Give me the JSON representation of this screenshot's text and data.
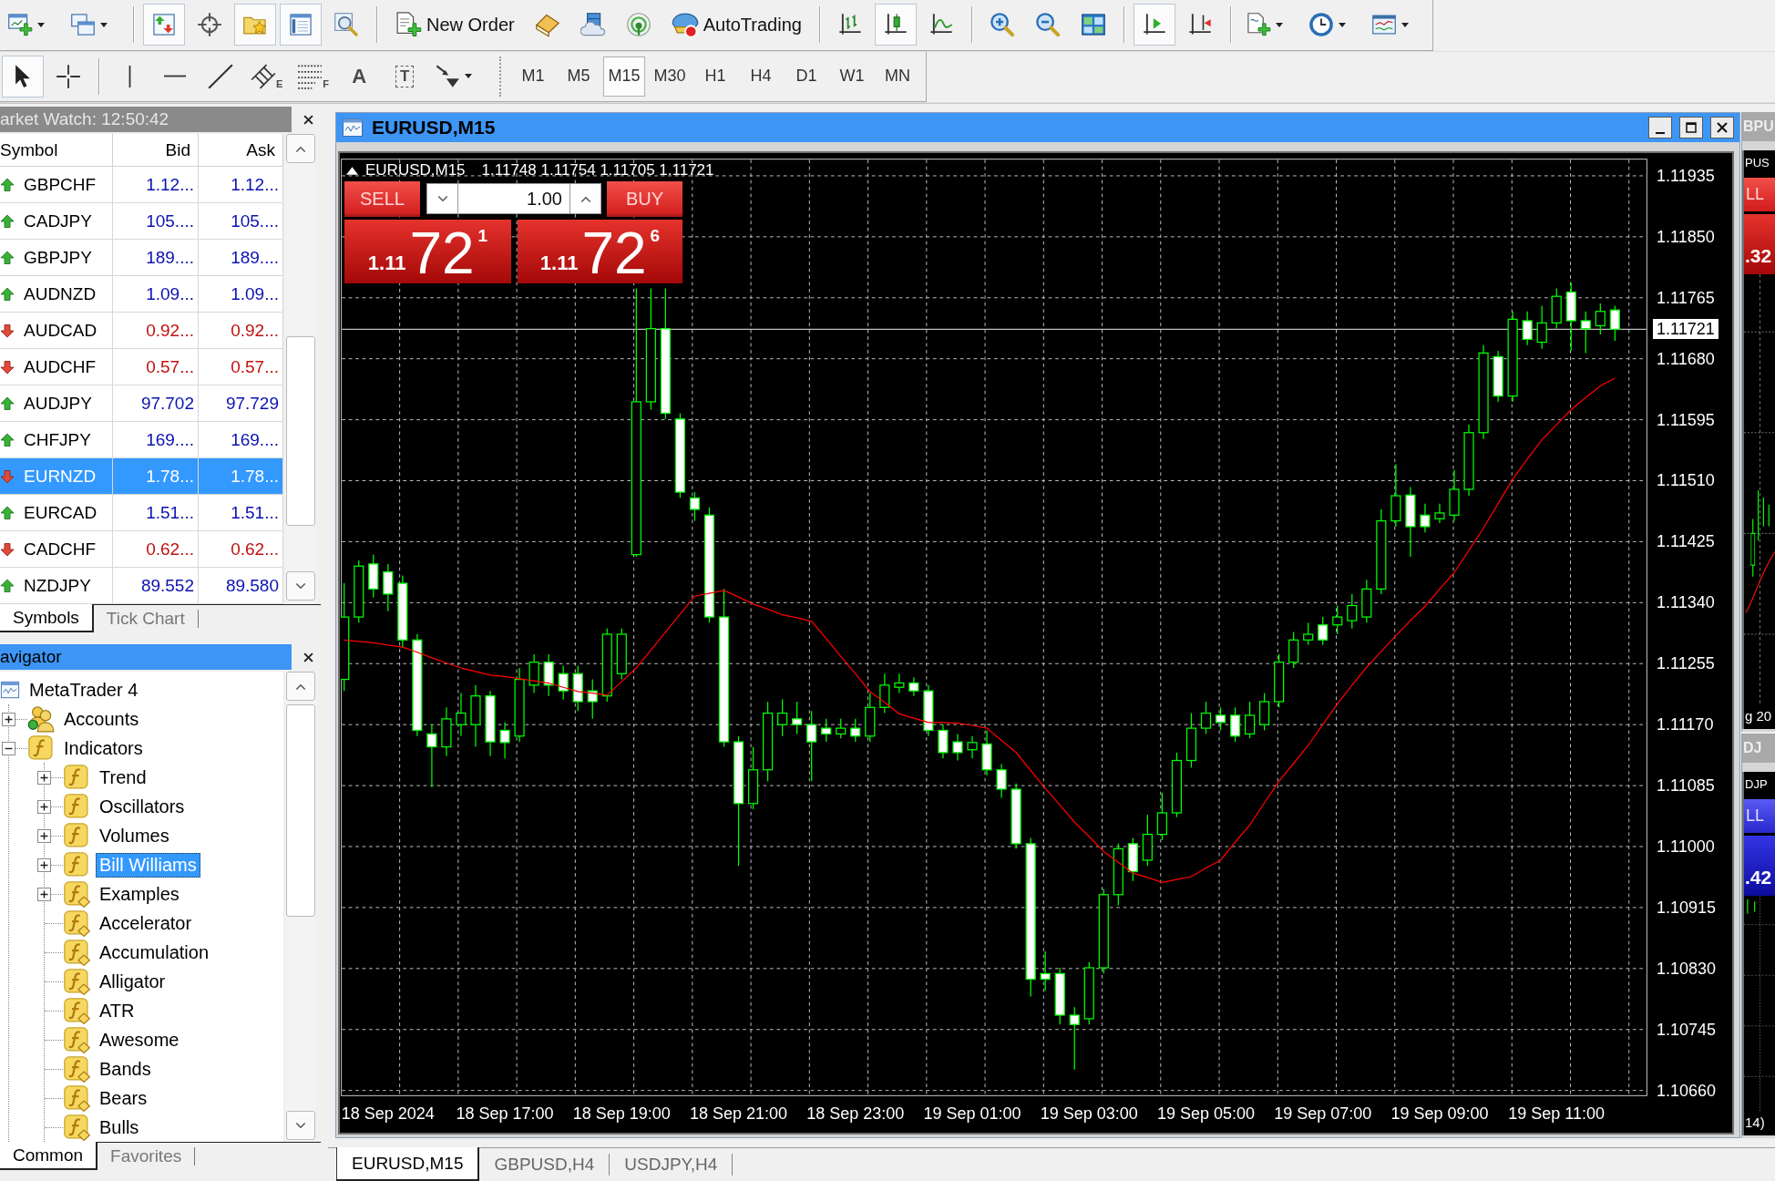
{
  "toolbars": [
    {
      "items": [
        {
          "kind": "new-chart",
          "dropdown": true,
          "pressed": false
        },
        {
          "kind": "profiles",
          "dropdown": true,
          "pressed": false
        },
        {
          "kind": "separator"
        },
        {
          "kind": "market-watch",
          "dropdown": false,
          "pressed": true
        },
        {
          "kind": "data-window",
          "dropdown": false,
          "pressed": false
        },
        {
          "kind": "navigator",
          "dropdown": false,
          "pressed": true
        },
        {
          "kind": "terminal",
          "dropdown": false,
          "pressed": true
        },
        {
          "kind": "tester",
          "dropdown": false,
          "pressed": false
        },
        {
          "kind": "separator"
        },
        {
          "kind": "new-order",
          "label": "New Order",
          "dropdown": false,
          "pressed": false
        },
        {
          "kind": "meta-editor",
          "dropdown": false,
          "pressed": false
        },
        {
          "kind": "cloud",
          "dropdown": false,
          "pressed": false
        },
        {
          "kind": "signals",
          "dropdown": false,
          "pressed": false
        },
        {
          "kind": "auto-trading",
          "label": "AutoTrading",
          "dropdown": false,
          "pressed": false
        },
        {
          "kind": "separator"
        },
        {
          "kind": "bar-chart",
          "dropdown": false,
          "pressed": false
        },
        {
          "kind": "candle-chart",
          "dropdown": false,
          "pressed": true
        },
        {
          "kind": "line-chart",
          "dropdown": false,
          "pressed": false
        },
        {
          "kind": "separator"
        },
        {
          "kind": "zoom-in",
          "dropdown": false,
          "pressed": false
        },
        {
          "kind": "zoom-out",
          "dropdown": false,
          "pressed": false
        },
        {
          "kind": "tile",
          "dropdown": false,
          "pressed": false
        },
        {
          "kind": "separator"
        },
        {
          "kind": "auto-scroll",
          "dropdown": false,
          "pressed": true
        },
        {
          "kind": "chart-shift",
          "dropdown": false,
          "pressed": false
        },
        {
          "kind": "separator"
        },
        {
          "kind": "indicators",
          "dropdown": true,
          "pressed": false
        },
        {
          "kind": "periods",
          "dropdown": true,
          "pressed": false
        },
        {
          "kind": "templates",
          "dropdown": true,
          "pressed": false
        }
      ]
    },
    {
      "items": [
        {
          "kind": "cursor",
          "dropdown": false,
          "pressed": true
        },
        {
          "kind": "crosshair",
          "dropdown": false,
          "pressed": false
        },
        {
          "kind": "separator"
        },
        {
          "kind": "vline",
          "dropdown": false,
          "pressed": false
        },
        {
          "kind": "hline",
          "dropdown": false,
          "pressed": false
        },
        {
          "kind": "trendline",
          "dropdown": false,
          "pressed": false
        },
        {
          "kind": "channel",
          "glyph": "E",
          "dropdown": false,
          "pressed": false
        },
        {
          "kind": "fibo",
          "glyph": "F",
          "dropdown": false,
          "pressed": false
        },
        {
          "kind": "text",
          "glyph": "A",
          "dropdown": false,
          "pressed": false
        },
        {
          "kind": "label",
          "glyph": "T",
          "dropdown": false,
          "pressed": false
        },
        {
          "kind": "arrows",
          "dropdown": true,
          "pressed": false
        },
        {
          "kind": "grip"
        },
        {
          "kind": "timeframe",
          "label": "M1",
          "pressed": false
        },
        {
          "kind": "timeframe",
          "label": "M5",
          "pressed": false
        },
        {
          "kind": "timeframe",
          "label": "M15",
          "pressed": true
        },
        {
          "kind": "timeframe",
          "label": "M30",
          "pressed": false
        },
        {
          "kind": "timeframe",
          "label": "H1",
          "pressed": false
        },
        {
          "kind": "timeframe",
          "label": "H4",
          "pressed": false
        },
        {
          "kind": "timeframe",
          "label": "D1",
          "pressed": false
        },
        {
          "kind": "timeframe",
          "label": "W1",
          "pressed": false
        },
        {
          "kind": "timeframe",
          "label": "MN",
          "pressed": false
        }
      ]
    }
  ],
  "market_watch": {
    "title": "arket Watch: 12:50:42",
    "active": false,
    "columns": [
      "Symbol",
      "Bid",
      "Ask"
    ],
    "rows": [
      {
        "symbol": "GBPCHF",
        "bid": "1.12...",
        "ask": "1.12...",
        "rising": true,
        "selected": false
      },
      {
        "symbol": "CADJPY",
        "bid": "105....",
        "ask": "105....",
        "rising": true,
        "selected": false
      },
      {
        "symbol": "GBPJPY",
        "bid": "189....",
        "ask": "189....",
        "rising": true,
        "selected": false
      },
      {
        "symbol": "AUDNZD",
        "bid": "1.09...",
        "ask": "1.09...",
        "rising": true,
        "selected": false
      },
      {
        "symbol": "AUDCAD",
        "bid": "0.92...",
        "ask": "0.92...",
        "rising": false,
        "selected": false
      },
      {
        "symbol": "AUDCHF",
        "bid": "0.57...",
        "ask": "0.57...",
        "rising": false,
        "selected": false
      },
      {
        "symbol": "AUDJPY",
        "bid": "97.702",
        "ask": "97.729",
        "rising": true,
        "selected": false
      },
      {
        "symbol": "CHFJPY",
        "bid": "169....",
        "ask": "169....",
        "rising": true,
        "selected": false
      },
      {
        "symbol": "EURNZD",
        "bid": "1.78...",
        "ask": "1.78...",
        "rising": false,
        "selected": true
      },
      {
        "symbol": "EURCAD",
        "bid": "1.51...",
        "ask": "1.51...",
        "rising": true,
        "selected": false
      },
      {
        "symbol": "CADCHF",
        "bid": "0.62...",
        "ask": "0.62...",
        "rising": false,
        "selected": false
      },
      {
        "symbol": "NZDJPY",
        "bid": "89.552",
        "ask": "89.580",
        "rising": true,
        "selected": false
      }
    ],
    "tabs": [
      {
        "label": "Symbols",
        "selected": true
      },
      {
        "label": "Tick Chart",
        "selected": false
      }
    ]
  },
  "navigator": {
    "title": "avigator",
    "active": true,
    "tree": [
      {
        "label": "MetaTrader 4",
        "kind": "terminal",
        "selected": false,
        "children": [
          {
            "label": "Accounts",
            "kind": "accounts",
            "expanded": false,
            "selected": false
          },
          {
            "label": "Indicators",
            "kind": "indicator",
            "expanded": true,
            "selected": false,
            "children": [
              {
                "label": "Trend",
                "kind": "indicator",
                "expanded": false,
                "selected": false
              },
              {
                "label": "Oscillators",
                "kind": "indicator",
                "expanded": false,
                "selected": false
              },
              {
                "label": "Volumes",
                "kind": "indicator",
                "expanded": false,
                "selected": false
              },
              {
                "label": "Bill Williams",
                "kind": "indicator",
                "expanded": false,
                "selected": true
              },
              {
                "label": "Examples",
                "kind": "custom",
                "expanded": false,
                "selected": false
              },
              {
                "label": "Accelerator",
                "kind": "custom",
                "selected": false
              },
              {
                "label": "Accumulation",
                "kind": "custom",
                "selected": false
              },
              {
                "label": "Alligator",
                "kind": "custom",
                "selected": false
              },
              {
                "label": "ATR",
                "kind": "custom",
                "selected": false
              },
              {
                "label": "Awesome",
                "kind": "custom",
                "selected": false
              },
              {
                "label": "Bands",
                "kind": "custom",
                "selected": false
              },
              {
                "label": "Bears",
                "kind": "custom",
                "selected": false
              },
              {
                "label": "Bulls",
                "kind": "custom",
                "selected": false
              }
            ]
          }
        ]
      }
    ],
    "tabs": [
      {
        "label": "Common",
        "selected": true
      },
      {
        "label": "Favorites",
        "selected": false
      }
    ]
  },
  "chart_window": {
    "title": "EURUSD,M15",
    "active": true,
    "symbol_label": "EURUSD,M15",
    "ohlc_text": "1.11748 1.11754 1.11705 1.11721",
    "trade_panel": {
      "rising": false,
      "sell": {
        "label": "SELL",
        "prefix": "1.11",
        "main": "72",
        "suffix": "1"
      },
      "lot": "1.00",
      "buy": {
        "label": "BUY",
        "prefix": "1.11",
        "main": "72",
        "suffix": "6"
      }
    },
    "chart_data": {
      "type": "candlestick",
      "grid": true,
      "categories": [
        null,
        null,
        null,
        "18 Sep 2024",
        null,
        null,
        null,
        null,
        null,
        null,
        null,
        "18 Sep 17:00",
        null,
        null,
        null,
        null,
        null,
        null,
        null,
        "18 Sep 19:00",
        null,
        null,
        null,
        null,
        null,
        null,
        null,
        "18 Sep 21:00",
        null,
        null,
        null,
        null,
        null,
        null,
        null,
        "18 Sep 23:00",
        null,
        null,
        null,
        null,
        null,
        null,
        null,
        "19 Sep 01:00",
        null,
        null,
        null,
        null,
        null,
        null,
        null,
        "19 Sep 03:00",
        null,
        null,
        null,
        null,
        null,
        null,
        null,
        "19 Sep 05:00",
        null,
        null,
        null,
        null,
        null,
        null,
        null,
        "19 Sep 07:00",
        null,
        null,
        null,
        null,
        null,
        null,
        null,
        "19 Sep 09:00",
        null,
        null,
        null,
        null,
        null,
        null,
        null,
        "19 Sep 11:00",
        null,
        null,
        null,
        null
      ],
      "ylim": [
        1.10652,
        1.11959
      ],
      "yticks": [
        {
          "value": 1.11935,
          "label": "1.11935"
        },
        {
          "value": 1.1185,
          "label": "1.11850"
        },
        {
          "value": 1.11765,
          "label": "1.11765"
        },
        {
          "value": 1.1168,
          "label": "1.11680"
        },
        {
          "value": 1.11595,
          "label": "1.11595"
        },
        {
          "value": 1.1151,
          "label": "1.11510"
        },
        {
          "value": 1.11425,
          "label": "1.11425"
        },
        {
          "value": 1.1134,
          "label": "1.11340"
        },
        {
          "value": 1.11255,
          "label": "1.11255"
        },
        {
          "value": 1.1117,
          "label": "1.11170"
        },
        {
          "value": 1.11085,
          "label": "1.11085"
        },
        {
          "value": 1.11,
          "label": "1.11000"
        },
        {
          "value": 1.10915,
          "label": "1.10915"
        },
        {
          "value": 1.1083,
          "label": "1.10830"
        },
        {
          "value": 1.10745,
          "label": "1.10745"
        },
        {
          "value": 1.1066,
          "label": "1.10660"
        }
      ],
      "ref_lines": [
        {
          "axis": "y",
          "value": 1.11721,
          "label": "1.11721"
        }
      ],
      "ohlc": [
        [
          1.11233,
          1.11367,
          1.11217,
          1.1132
        ],
        [
          1.1132,
          1.11399,
          1.11312,
          1.11391
        ],
        [
          1.11394,
          1.11407,
          1.11347,
          1.11359
        ],
        [
          1.11383,
          1.11394,
          1.11328,
          1.11352
        ],
        [
          1.11367,
          1.11378,
          1.11277,
          1.11288
        ],
        [
          1.11288,
          1.11296,
          1.11154,
          1.11162
        ],
        [
          1.11157,
          1.1117,
          1.11083,
          1.11139
        ],
        [
          1.11139,
          1.11194,
          1.11126,
          1.11178
        ],
        [
          1.1117,
          1.11214,
          1.11154,
          1.11186
        ],
        [
          1.1117,
          1.11225,
          1.11139,
          1.1121
        ],
        [
          1.1121,
          1.11217,
          1.11126,
          1.11146
        ],
        [
          1.11162,
          1.11173,
          1.11123,
          1.11145
        ],
        [
          1.11154,
          1.11249,
          1.11146,
          1.11233
        ],
        [
          1.11225,
          1.11268,
          1.11214,
          1.11257
        ],
        [
          1.11257,
          1.11268,
          1.1121,
          1.11225
        ],
        [
          1.11241,
          1.11252,
          1.11205,
          1.11217
        ],
        [
          1.11241,
          1.11252,
          1.11189,
          1.11202
        ],
        [
          1.11217,
          1.11233,
          1.11178,
          1.11202
        ],
        [
          1.1121,
          1.11304,
          1.11202,
          1.11296
        ],
        [
          1.11241,
          1.11304,
          1.11233,
          1.11296
        ],
        [
          1.11407,
          1.11778,
          1.11404,
          1.1162
        ],
        [
          1.1162,
          1.11778,
          1.11609,
          1.11722
        ],
        [
          1.11722,
          1.11778,
          1.11596,
          1.11604
        ],
        [
          1.11596,
          1.11604,
          1.11486,
          1.11494
        ],
        [
          1.11486,
          1.11494,
          1.11454,
          1.1147
        ],
        [
          1.11462,
          1.11473,
          1.11312,
          1.1132
        ],
        [
          1.1132,
          1.11359,
          1.11139,
          1.11146
        ],
        [
          1.11146,
          1.11154,
          1.10973,
          1.1106
        ],
        [
          1.1106,
          1.11139,
          1.11052,
          1.11107
        ],
        [
          1.11107,
          1.11202,
          1.11091,
          1.11186
        ],
        [
          1.1117,
          1.11205,
          1.11154,
          1.11186
        ],
        [
          1.11178,
          1.11202,
          1.11157,
          1.1117
        ],
        [
          1.1117,
          1.11189,
          1.11091,
          1.11146
        ],
        [
          1.11165,
          1.11178,
          1.11146,
          1.11157
        ],
        [
          1.11157,
          1.11178,
          1.11151,
          1.11165
        ],
        [
          1.11165,
          1.11178,
          1.11146,
          1.11154
        ],
        [
          1.11154,
          1.11214,
          1.11146,
          1.11194
        ],
        [
          1.11194,
          1.11241,
          1.11186,
          1.11225
        ],
        [
          1.11222,
          1.11241,
          1.11214,
          1.11228
        ],
        [
          1.11228,
          1.11236,
          1.1121,
          1.11217
        ],
        [
          1.11217,
          1.11225,
          1.11154,
          1.11162
        ],
        [
          1.11162,
          1.1117,
          1.11123,
          1.11131
        ],
        [
          1.11146,
          1.11157,
          1.1112,
          1.11131
        ],
        [
          1.11135,
          1.11154,
          1.11123,
          1.11145
        ],
        [
          1.11143,
          1.11162,
          1.11099,
          1.11107
        ],
        [
          1.11107,
          1.11115,
          1.11068,
          1.1108
        ],
        [
          1.1108,
          1.11088,
          1.10997,
          1.11004
        ],
        [
          1.11004,
          1.11012,
          1.10791,
          1.10815
        ],
        [
          1.10823,
          1.10854,
          1.10799,
          1.10815
        ],
        [
          1.10823,
          1.10831,
          1.10752,
          1.10765
        ],
        [
          1.10765,
          1.10776,
          1.10689,
          1.10752
        ],
        [
          1.1076,
          1.10839,
          1.10752,
          1.10831
        ],
        [
          1.10831,
          1.10941,
          1.10823,
          1.10933
        ],
        [
          1.10933,
          1.11004,
          1.10918,
          1.10997
        ],
        [
          1.11004,
          1.11012,
          1.10952,
          1.10965
        ],
        [
          1.10981,
          1.11044,
          1.10973,
          1.11017
        ],
        [
          1.11017,
          1.11075,
          1.11009,
          1.11047
        ],
        [
          1.11047,
          1.11131,
          1.11041,
          1.1112
        ],
        [
          1.1112,
          1.11186,
          1.1111,
          1.11165
        ],
        [
          1.11165,
          1.11202,
          1.11157,
          1.11186
        ],
        [
          1.11183,
          1.11194,
          1.11162,
          1.11173
        ],
        [
          1.11183,
          1.11194,
          1.11146,
          1.11154
        ],
        [
          1.11157,
          1.11202,
          1.11151,
          1.11183
        ],
        [
          1.1117,
          1.11214,
          1.11162,
          1.11202
        ],
        [
          1.11202,
          1.11268,
          1.11194,
          1.11257
        ],
        [
          1.11257,
          1.11299,
          1.11249,
          1.11288
        ],
        [
          1.11288,
          1.11312,
          1.11281,
          1.11296
        ],
        [
          1.11309,
          1.1132,
          1.11281,
          1.11288
        ],
        [
          1.11309,
          1.11336,
          1.11296,
          1.1132
        ],
        [
          1.11315,
          1.11352,
          1.11304,
          1.11336
        ],
        [
          1.1132,
          1.11372,
          1.11312,
          1.11359
        ],
        [
          1.11359,
          1.1147,
          1.11352,
          1.11454
        ],
        [
          1.11454,
          1.11533,
          1.11446,
          1.11489
        ],
        [
          1.1149,
          1.11501,
          1.11404,
          1.11446
        ],
        [
          1.11462,
          1.11478,
          1.11438,
          1.11446
        ],
        [
          1.11457,
          1.11478,
          1.11451,
          1.11465
        ],
        [
          1.11462,
          1.11525,
          1.11454,
          1.11498
        ],
        [
          1.11498,
          1.11588,
          1.11489,
          1.11577
        ],
        [
          1.11577,
          1.11699,
          1.11568,
          1.11688
        ],
        [
          1.11683,
          1.11691,
          1.1162,
          1.11628
        ],
        [
          1.11628,
          1.11746,
          1.1162,
          1.11735
        ],
        [
          1.11733,
          1.11746,
          1.11699,
          1.11707
        ],
        [
          1.11703,
          1.11754,
          1.11694,
          1.1173
        ],
        [
          1.1173,
          1.11778,
          1.11722,
          1.11767
        ],
        [
          1.11773,
          1.11786,
          1.11691,
          1.11733
        ],
        [
          1.11733,
          1.11746,
          1.11688,
          1.11722
        ],
        [
          1.11726,
          1.11757,
          1.11714,
          1.11746
        ],
        [
          1.11748,
          1.11754,
          1.11705,
          1.11721
        ]
      ],
      "series": [
        {
          "type": "line",
          "color": "#ff0000",
          "values": [
            1.11288,
            1.11286,
            1.11284,
            1.11281,
            1.11278,
            1.11271,
            1.11263,
            1.11256,
            1.11249,
            1.11244,
            1.11239,
            1.11237,
            1.11234,
            1.11231,
            1.11228,
            1.11222,
            1.11216,
            1.11214,
            1.11211,
            1.1123,
            1.11249,
            1.11274,
            1.11299,
            1.11324,
            1.11349,
            1.11353,
            1.11357,
            1.11348,
            1.11338,
            1.11331,
            1.11323,
            1.11319,
            1.11314,
            1.1129,
            1.11265,
            1.11241,
            1.11216,
            1.11201,
            1.11185,
            1.11179,
            1.11173,
            1.11173,
            1.11172,
            1.11169,
            1.11165,
            1.11148,
            1.11131,
            1.11106,
            1.11081,
            1.11058,
            1.11034,
            1.11014,
            1.10993,
            1.10978,
            1.10963,
            1.10957,
            1.1095,
            1.10954,
            1.10958,
            1.1097,
            1.10981,
            1.11006,
            1.1103,
            1.11061,
            1.11091,
            1.11116,
            1.11141,
            1.1117,
            1.11199,
            1.11225,
            1.1125,
            1.11272,
            1.11294,
            1.11315,
            1.11335,
            1.11359,
            1.11382,
            1.11413,
            1.11444,
            1.11478,
            1.11512,
            1.1154,
            1.11567,
            1.11588,
            1.11609,
            1.11626,
            1.11642,
            1.11653
          ]
        }
      ]
    }
  },
  "background_windows": [
    {
      "title": "BPU",
      "active": false,
      "info": "PUS",
      "sell": "LL",
      "price": ".32",
      "rising": false,
      "time": "g 20"
    },
    {
      "title": "DJ",
      "active": false,
      "info": "DJP",
      "sell": "LL",
      "price": ".42",
      "rising": true,
      "time": "14)"
    }
  ],
  "window_tabs": [
    {
      "label": "EURUSD,M15",
      "selected": true
    },
    {
      "label": "GBPUSD,H4",
      "selected": false
    },
    {
      "label": "USDJPY,H4",
      "selected": false
    }
  ]
}
